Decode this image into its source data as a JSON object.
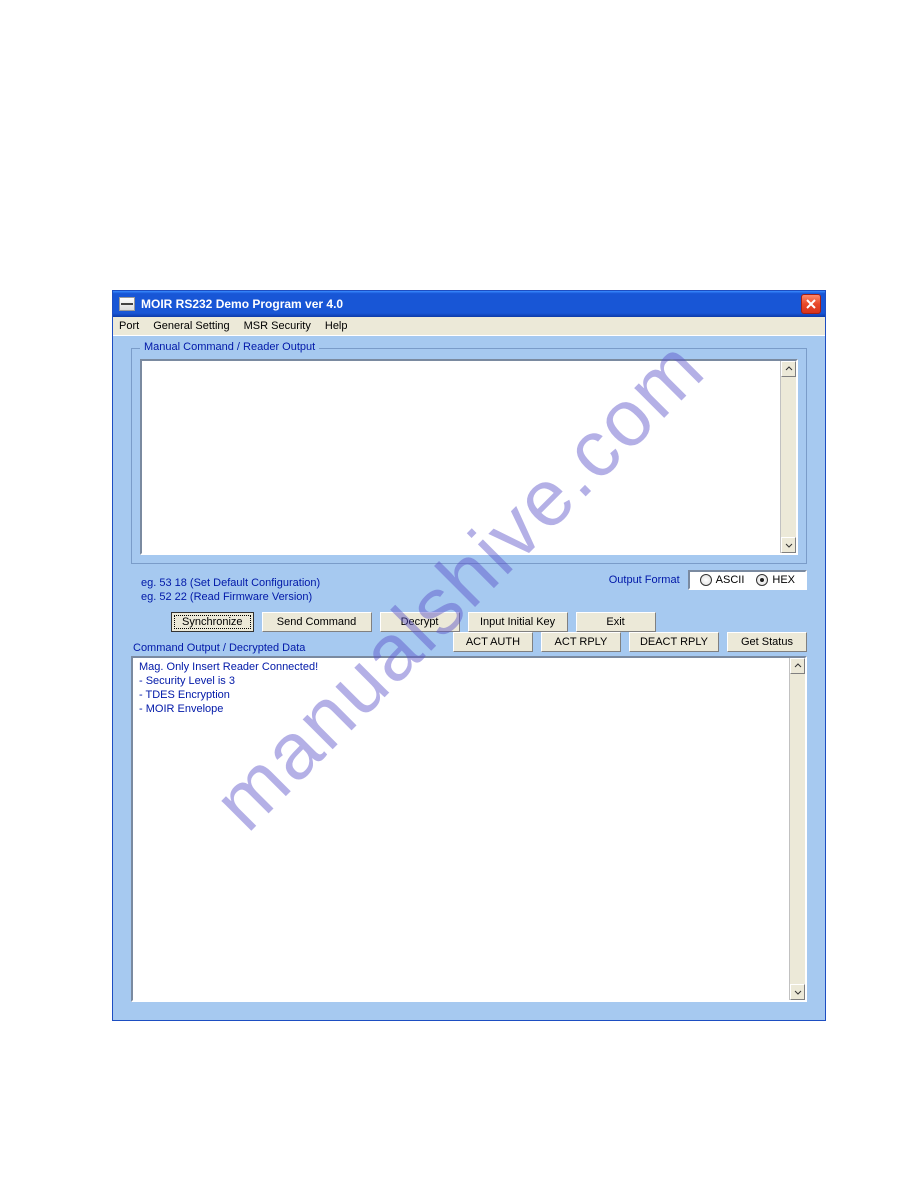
{
  "watermark": "manualshive.com",
  "window": {
    "title": "MOIR RS232 Demo Program ver 4.0"
  },
  "menu": {
    "port": "Port",
    "general": "General Setting",
    "msr": "MSR Security",
    "help": "Help"
  },
  "group1": {
    "label": "Manual Command / Reader Output"
  },
  "examples": {
    "l1": "eg. 53 18 (Set Default Configuration)",
    "l2": "eg. 52 22 (Read Firmware Version)"
  },
  "outputFormat": {
    "label": "Output Format",
    "ascii": "ASCII",
    "hex": "HEX",
    "selected": "HEX"
  },
  "buttons": {
    "sync": "Synchronize",
    "send": "Send Command",
    "decrypt": "Decrypt",
    "inputkey": "Input Initial Key",
    "exit": "Exit",
    "actauth": "ACT AUTH",
    "actrply": "ACT RPLY",
    "deactrply": "DEACT RPLY",
    "getstatus": "Get Status"
  },
  "group2": {
    "label": "Command Output / Decrypted Data",
    "lines": {
      "l0": "Mag. Only Insert Reader Connected!",
      "l1": "- Security Level is 3",
      "l2": "- TDES Encryption",
      "l3": "- MOIR Envelope"
    }
  }
}
